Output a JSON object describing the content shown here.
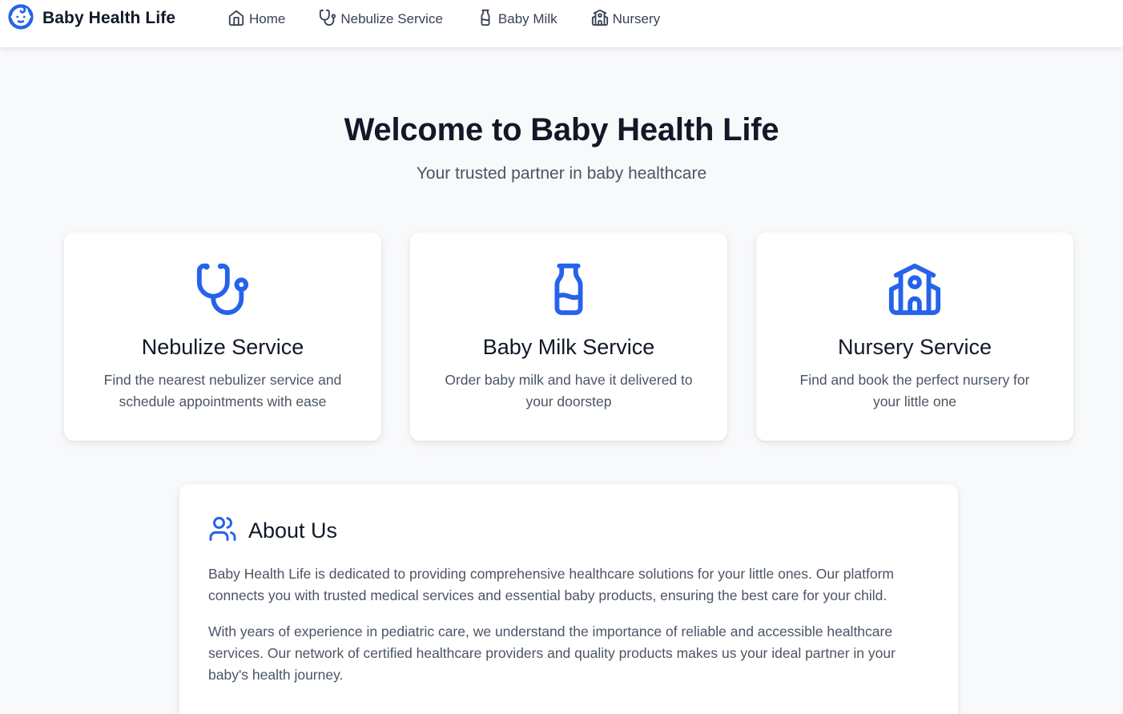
{
  "brand": {
    "name": "Baby Health Life",
    "icon": "baby-face-icon"
  },
  "nav": {
    "items": [
      {
        "label": "Home",
        "icon": "home-icon"
      },
      {
        "label": "Nebulize Service",
        "icon": "stethoscope-icon"
      },
      {
        "label": "Baby Milk",
        "icon": "milk-bottle-icon"
      },
      {
        "label": "Nursery",
        "icon": "school-building-icon"
      }
    ]
  },
  "hero": {
    "title": "Welcome to Baby Health Life",
    "subtitle": "Your trusted partner in baby healthcare"
  },
  "services": [
    {
      "title": "Nebulize Service",
      "description": "Find the nearest nebulizer service and schedule appointments with ease",
      "icon": "stethoscope-icon"
    },
    {
      "title": "Baby Milk Service",
      "description": "Order baby milk and have it delivered to your doorstep",
      "icon": "milk-bottle-icon"
    },
    {
      "title": "Nursery Service",
      "description": "Find and book the perfect nursery for your little one",
      "icon": "school-building-icon"
    }
  ],
  "about": {
    "title": "About Us",
    "icon": "users-icon",
    "paragraphs": [
      "Baby Health Life is dedicated to providing comprehensive healthcare solutions for your little ones. Our platform connects you with trusted medical services and essential baby products, ensuring the best care for your child.",
      "With years of experience in pediatric care, we understand the importance of reliable and accessible healthcare services. Our network of certified healthcare providers and quality products makes us your ideal partner in your baby's health journey."
    ]
  },
  "colors": {
    "accent": "#2563eb",
    "background": "#f8f9fb",
    "card": "#ffffff",
    "heading": "#111827",
    "body_text": "#4b5563"
  }
}
